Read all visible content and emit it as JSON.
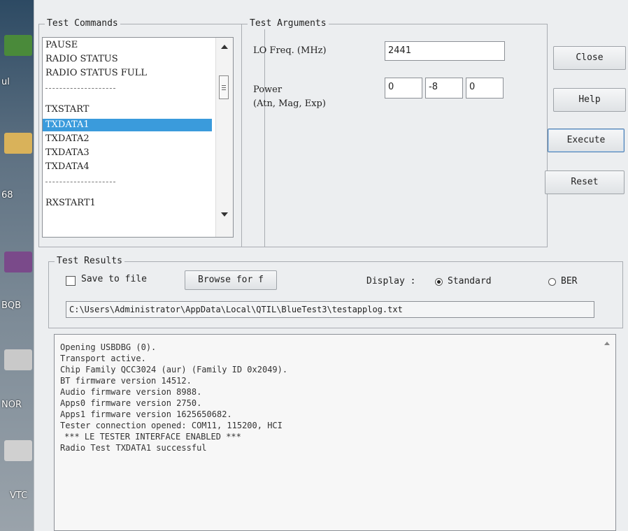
{
  "desktop": {
    "labels": [
      "ul",
      "68",
      "BQB",
      "NOR",
      "VTC"
    ]
  },
  "commands": {
    "title": "Test Commands",
    "items": [
      {
        "label": "PAUSE",
        "selected": false
      },
      {
        "label": "RADIO STATUS",
        "selected": false
      },
      {
        "label": "RADIO STATUS FULL",
        "selected": false
      },
      {
        "label": "TXSTART",
        "selected": false
      },
      {
        "label": "TXDATA1",
        "selected": true
      },
      {
        "label": "TXDATA2",
        "selected": false
      },
      {
        "label": "TXDATA3",
        "selected": false
      },
      {
        "label": "TXDATA4",
        "selected": false
      },
      {
        "label": "RXSTART1",
        "selected": false
      }
    ]
  },
  "arguments": {
    "title": "Test Arguments",
    "lo_freq_label": "LO Freq. (MHz)",
    "lo_freq_value": "2441",
    "power_label": "Power",
    "power_sublabel": "(Atn, Mag, Exp)",
    "power_atn": "0",
    "power_mag": "-8",
    "power_exp": "0"
  },
  "buttons": {
    "close": "Close",
    "help": "Help",
    "execute": "Execute",
    "reset": "Reset"
  },
  "results": {
    "title": "Test Results",
    "save_to_file": "Save to file",
    "save_checked": false,
    "browse": "Browse for f",
    "display_label": "Display :",
    "standard": "Standard",
    "ber": "BER",
    "display_selected": "Standard",
    "path": "C:\\Users\\Administrator\\AppData\\Local\\QTIL\\BlueTest3\\testapplog.txt"
  },
  "log": {
    "lines": [
      "Opening USBDBG (0).",
      "Transport active.",
      "Chip Family QCC3024 (aur) (Family ID 0x2049).",
      "BT firmware version 14512.",
      "Audio firmware version 8988.",
      "Apps0 firmware version 2750.",
      "Apps1 firmware version 1625650682.",
      "Tester connection opened: COM11, 115200, HCI",
      "*** LE TESTER INTERFACE ENABLED ***",
      "Radio Test TXDATA1 successful"
    ]
  },
  "colors": {
    "selection": "#3a9bdc",
    "dialog_bg": "#eceef0"
  }
}
